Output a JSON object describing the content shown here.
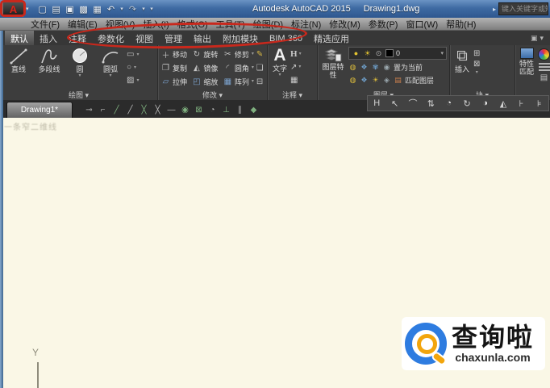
{
  "window": {
    "logo_letter": "A",
    "app_title": "Autodesk AutoCAD 2015",
    "doc_title": "Drawing1.dwg",
    "search_placeholder": "键入关键字或短语"
  },
  "menu": {
    "items": [
      "文件(F)",
      "编辑(E)",
      "视图(V)",
      "插入(I)",
      "格式(O)",
      "工具(T)",
      "绘图(D)",
      "标注(N)",
      "修改(M)",
      "参数(P)",
      "窗口(W)",
      "帮助(H)"
    ]
  },
  "tabs": {
    "items": [
      "默认",
      "插入",
      "注释",
      "参数化",
      "视图",
      "管理",
      "输出",
      "附加模块",
      "BIM 360",
      "精选应用"
    ]
  },
  "ribbon": {
    "draw": {
      "label": "绘图",
      "tools": [
        "直线",
        "多段线",
        "圆",
        "圆弧"
      ]
    },
    "modify": {
      "label": "修改",
      "rows": [
        [
          "移动",
          "旋转",
          "修剪"
        ],
        [
          "复制",
          "镜像",
          "圆角"
        ],
        [
          "拉伸",
          "缩放",
          "阵列"
        ]
      ]
    },
    "annotate": {
      "label": "注释",
      "big_letter": "A",
      "text_tool": "文字"
    },
    "layers": {
      "label": "图层",
      "properties_button": "图层特性",
      "current_layer": "0",
      "set_current": "置为当前",
      "match_layer": "匹配图层"
    },
    "block": {
      "label": "块",
      "insert_tool": "插入"
    },
    "properties": {
      "match_tool": "特性匹配"
    }
  },
  "file_tabs": {
    "active": "Drawing1*"
  },
  "canvas": {
    "ghost_text": "一条窄二维线",
    "ucs_y": "Y"
  },
  "watermark": {
    "title": "查询啦",
    "domain": "chaxunla.com"
  },
  "colors": {
    "annotation_red": "#c9281c",
    "titlebar_blue": "#3f6ba3",
    "canvas_cream": "#faf7e6",
    "ribbon_dark": "#3d3d3d",
    "watermark_blue": "#2e7ce0",
    "watermark_orange": "#f2a50c"
  },
  "icon_strips": {
    "qat": [
      {
        "g": "▢",
        "c": "#e9eef5",
        "n": "new-file-icon"
      },
      {
        "g": "▤",
        "c": "#e9eef5",
        "n": "open-file-icon"
      },
      {
        "g": "▣",
        "c": "#e9eef5",
        "n": "save-icon"
      },
      {
        "g": "▩",
        "c": "#e9eef5",
        "n": "save-as-icon"
      },
      {
        "g": "▦",
        "c": "#e9eef5",
        "n": "plot-icon"
      },
      {
        "g": "↶",
        "c": "#e9eef5",
        "n": "undo-icon"
      },
      {
        "g": "▾",
        "c": "#cfd9e6",
        "n": "undo-dropdown-icon",
        "s": 1
      },
      {
        "g": "↷",
        "c": "#b9c6d6",
        "n": "redo-icon"
      },
      {
        "g": "▾",
        "c": "#cfd9e6",
        "n": "redo-dropdown-icon",
        "s": 1
      },
      {
        "g": "▾",
        "c": "#cfd9e6",
        "n": "qat-customize-icon",
        "s": 1
      }
    ],
    "osnap": [
      {
        "g": "⊸",
        "c": "#b9b9b9",
        "n": "snap-tracking-icon"
      },
      {
        "g": "⌐",
        "c": "#b9b9b9",
        "n": "snap-from-icon"
      },
      {
        "g": "╱",
        "c": "#7fb07f",
        "n": "snap-endpoint-icon"
      },
      {
        "g": "╱",
        "c": "#b9b9b9",
        "n": "snap-midpoint-icon"
      },
      {
        "g": "╳",
        "c": "#7fb07f",
        "n": "snap-intersection-icon"
      },
      {
        "g": "╳",
        "c": "#b9b9b9",
        "n": "snap-apparent-icon"
      },
      {
        "g": "—",
        "c": "#b9b9b9",
        "n": "snap-extension-icon"
      },
      {
        "g": "◉",
        "c": "#7fb07f",
        "n": "snap-center-icon"
      },
      {
        "g": "⊠",
        "c": "#7fb07f",
        "n": "snap-node-icon"
      },
      {
        "g": "◔",
        "c": "#b9b9b9",
        "n": "snap-quadrant-icon"
      },
      {
        "g": "⊥",
        "c": "#7fb07f",
        "n": "snap-perpendicular-icon"
      },
      {
        "g": "∥",
        "c": "#b9b9b9",
        "n": "snap-parallel-icon"
      },
      {
        "g": "◆",
        "c": "#7fb07f",
        "n": "snap-insert-icon"
      }
    ],
    "measure": [
      {
        "g": "Η",
        "c": "#d2d2d2",
        "n": "dim-linear-icon"
      },
      {
        "g": "↖",
        "c": "#d2d2d2",
        "n": "multileader-icon"
      },
      {
        "g": "⌒",
        "c": "#d2d2d2",
        "n": "arc-length-icon"
      },
      {
        "g": "⇅",
        "c": "#d2d2d2",
        "n": "ordinate-icon"
      },
      {
        "g": "◔",
        "c": "#e8e8e8",
        "n": "angle-icon"
      },
      {
        "g": "↻",
        "c": "#d2d2d2",
        "n": "radius-icon"
      },
      {
        "g": "◑",
        "c": "#e8e8e8",
        "n": "diameter-icon"
      },
      {
        "g": "◭",
        "c": "#d2d2d2",
        "n": "area-icon"
      },
      {
        "g": "⊦",
        "c": "#d2d2d2",
        "n": "jog-icon"
      },
      {
        "g": "⊧",
        "c": "#d2d2d2",
        "n": "baseline-icon"
      }
    ]
  }
}
